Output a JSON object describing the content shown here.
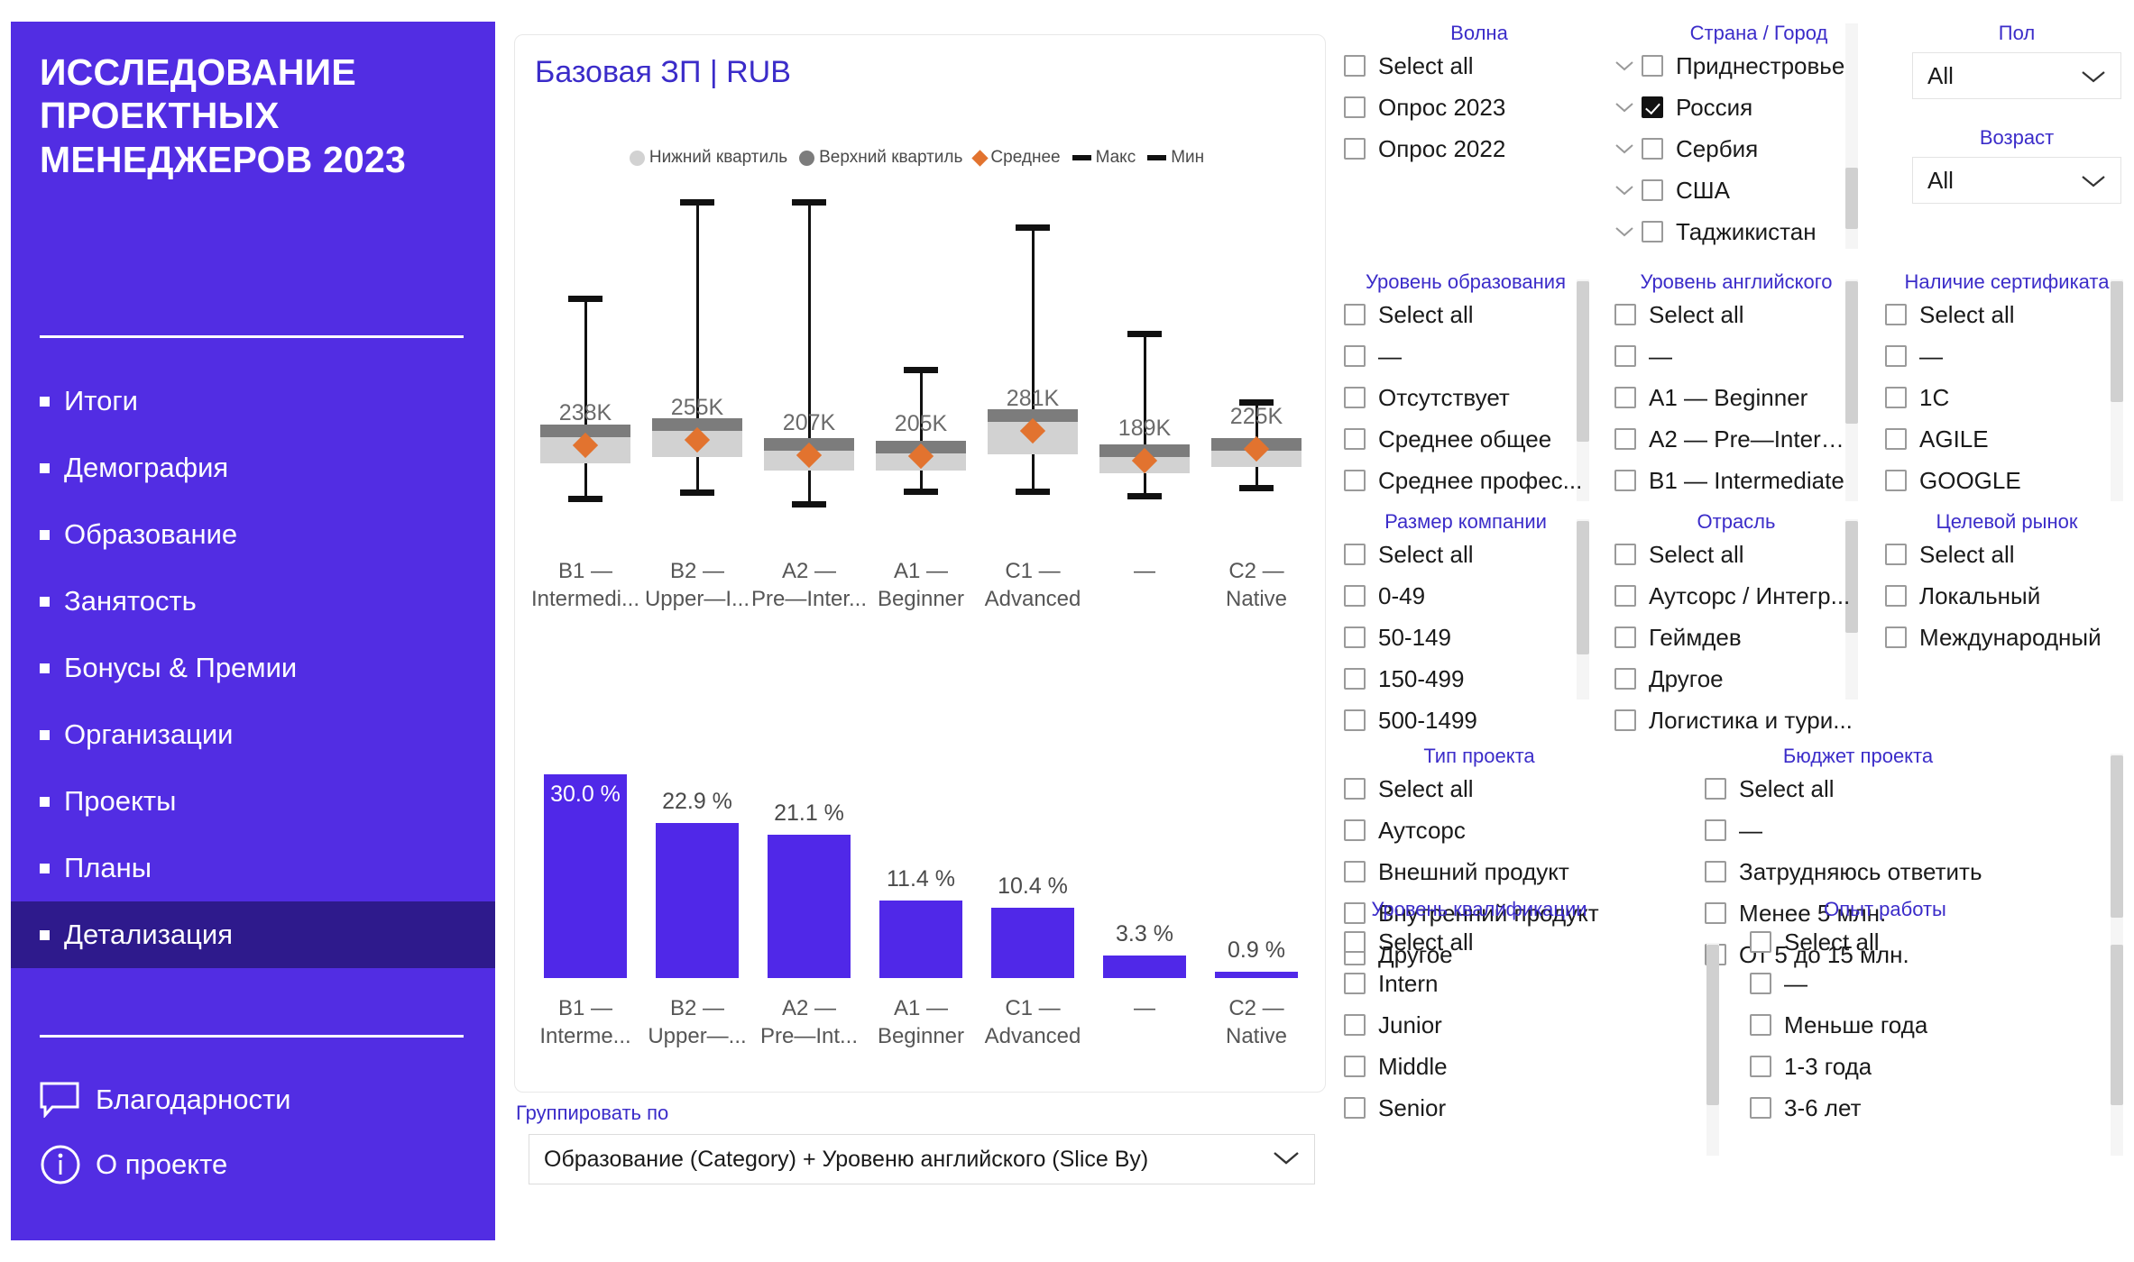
{
  "sidebar": {
    "brand_title": "ИССЛЕДОВАНИЕ ПРОЕКТНЫХ МЕНЕДЖЕРОВ 2023",
    "accent_color": "#522DE3",
    "active_color": "#2E1A8C",
    "items": [
      {
        "label": "Итоги",
        "active": false
      },
      {
        "label": "Демография",
        "active": false
      },
      {
        "label": "Образование",
        "active": false
      },
      {
        "label": "Занятость",
        "active": false
      },
      {
        "label": "Бонусы & Премии",
        "active": false
      },
      {
        "label": "Организации",
        "active": false
      },
      {
        "label": "Проекты",
        "active": false
      },
      {
        "label": "Планы",
        "active": false
      },
      {
        "label": "Детализация",
        "active": true
      }
    ],
    "footer": [
      {
        "label": "Благодарности",
        "icon": "speech-bubble-icon"
      },
      {
        "label": "О проекте",
        "icon": "info-circle-icon"
      }
    ]
  },
  "card": {
    "title": "Базовая ЗП | RUB",
    "legend": [
      {
        "label": "Нижний квартиль",
        "marker": "circle",
        "color": "#D2D2D2"
      },
      {
        "label": "Верхний квартиль",
        "marker": "circle",
        "color": "#7C7C7C"
      },
      {
        "label": "Среднее",
        "marker": "diamond",
        "color": "#E2732F"
      },
      {
        "label": "Макс",
        "marker": "dash",
        "color": "#111111"
      },
      {
        "label": "Мин",
        "marker": "dash",
        "color": "#111111"
      }
    ],
    "groupby_label": "Группировать по",
    "groupby_value": "Образование (Category) + Уровеню английского (Slice By)"
  },
  "chart_data": [
    {
      "type": "boxplot",
      "title": "Базовая ЗП | RUB",
      "xlabel": "",
      "ylabel": "RUB",
      "unit": "RUB",
      "value_suffix": "K",
      "categories": [
        "B1 — Intermedi...",
        "B2 — Upper—I...",
        "A2 — Pre—Inter...",
        "A1 — Beginner",
        "C1 — Advanced",
        "—",
        "C2 — Native"
      ],
      "category_lines": [
        [
          "B1 —",
          "Intermedi..."
        ],
        [
          "B2 —",
          "Upper—I..."
        ],
        [
          "A2 —",
          "Pre—Inter..."
        ],
        [
          "A1 —",
          "Beginner"
        ],
        [
          "C1 —",
          "Advanced"
        ],
        [
          "—",
          ""
        ],
        [
          "C2 —",
          "Native"
        ]
      ],
      "mean_labels": [
        "238K",
        "255K",
        "207K",
        "205K",
        "281K",
        "189K",
        "225K"
      ],
      "means": [
        238000,
        255000,
        207000,
        205000,
        281000,
        189000,
        225000
      ],
      "series": [
        {
          "name": "Макс",
          "values": [
            700000,
            1000000,
            1000000,
            480000,
            920000,
            590000,
            380000
          ]
        },
        {
          "name": "Верхний квартиль",
          "values": [
            300000,
            320000,
            260000,
            250000,
            350000,
            240000,
            260000
          ]
        },
        {
          "name": "Нижний квартиль",
          "values": [
            180000,
            200000,
            160000,
            160000,
            210000,
            150000,
            170000
          ]
        },
        {
          "name": "Мин",
          "values": [
            60000,
            80000,
            45000,
            85000,
            85000,
            70000,
            95000
          ]
        }
      ],
      "legend_position": "top",
      "grid": false
    },
    {
      "type": "bar",
      "title": "",
      "xlabel": "",
      "ylabel": "%",
      "categories": [
        "B1 — Interme...",
        "B2 — Upper—...",
        "A2 — Pre—Int...",
        "A1 — Beginner",
        "C1 — Advanced",
        "—",
        "C2 — Native"
      ],
      "category_lines": [
        [
          "B1 —",
          "Interme..."
        ],
        [
          "B2 —",
          "Upper—..."
        ],
        [
          "A2 —",
          "Pre—Int..."
        ],
        [
          "A1 —",
          "Beginner"
        ],
        [
          "C1 —",
          "Advanced"
        ],
        [
          "—",
          ""
        ],
        [
          "C2 —",
          "Native"
        ]
      ],
      "values": [
        30.0,
        22.9,
        21.1,
        11.4,
        10.4,
        3.3,
        0.9
      ],
      "value_labels": [
        "30.0 %",
        "22.9 %",
        "21.1 %",
        "11.4 %",
        "10.4 %",
        "3.3 %",
        "0.9 %"
      ],
      "ylim": [
        0,
        30.0
      ],
      "bar_color": "#5028E8",
      "grid": false,
      "legend_position": "none"
    }
  ],
  "slicers": {
    "wave": {
      "title": "Волна",
      "options": [
        {
          "label": "Select all",
          "checked": false
        },
        {
          "label": "Опрос 2023",
          "checked": false
        },
        {
          "label": "Опрос 2022",
          "checked": false
        }
      ]
    },
    "country": {
      "title": "Страна / Город",
      "options": [
        {
          "label": "Приднестровье",
          "checked": false,
          "expandable": true
        },
        {
          "label": "Россия",
          "checked": true,
          "expandable": true
        },
        {
          "label": "Сербия",
          "checked": false,
          "expandable": true
        },
        {
          "label": "США",
          "checked": false,
          "expandable": true
        },
        {
          "label": "Таджикистан",
          "checked": false,
          "expandable": true
        }
      ]
    },
    "gender": {
      "title": "Пол",
      "value": "All"
    },
    "age": {
      "title": "Возраст",
      "value": "All"
    },
    "education": {
      "title": "Уровень образования",
      "options": [
        {
          "label": "Select all",
          "checked": false
        },
        {
          "label": "—",
          "checked": false
        },
        {
          "label": "Отсутствует",
          "checked": false
        },
        {
          "label": "Среднее общее",
          "checked": false
        },
        {
          "label": "Среднее профес...",
          "checked": false
        }
      ]
    },
    "english": {
      "title": "Уровень английского",
      "options": [
        {
          "label": "Select all",
          "checked": false
        },
        {
          "label": "—",
          "checked": false
        },
        {
          "label": "A1 — Beginner",
          "checked": false
        },
        {
          "label": "A2 — Pre—Interm...",
          "checked": false
        },
        {
          "label": "B1 — Intermediate",
          "checked": false
        }
      ]
    },
    "certificate": {
      "title": "Наличие сертификата",
      "options": [
        {
          "label": "Select all",
          "checked": false
        },
        {
          "label": "—",
          "checked": false
        },
        {
          "label": "1C",
          "checked": false
        },
        {
          "label": "AGILE",
          "checked": false
        },
        {
          "label": "GOOGLE",
          "checked": false
        }
      ]
    },
    "company_size": {
      "title": "Размер компании",
      "options": [
        {
          "label": "Select all",
          "checked": false
        },
        {
          "label": "0-49",
          "checked": false
        },
        {
          "label": "50-149",
          "checked": false
        },
        {
          "label": "150-499",
          "checked": false
        },
        {
          "label": "500-1499",
          "checked": false
        }
      ]
    },
    "industry": {
      "title": "Отрасль",
      "options": [
        {
          "label": "Select all",
          "checked": false
        },
        {
          "label": "Аутсорс / Интегр...",
          "checked": false
        },
        {
          "label": "Геймдев",
          "checked": false
        },
        {
          "label": "Другое",
          "checked": false
        },
        {
          "label": "Логистика и тури...",
          "checked": false
        }
      ]
    },
    "target_market": {
      "title": "Целевой рынок",
      "options": [
        {
          "label": "Select all",
          "checked": false
        },
        {
          "label": "Локальный",
          "checked": false
        },
        {
          "label": "Международный",
          "checked": false
        }
      ]
    },
    "project_type": {
      "title": "Тип проекта",
      "options": [
        {
          "label": "Select all",
          "checked": false
        },
        {
          "label": "Аутсорс",
          "checked": false
        },
        {
          "label": "Внешний продукт",
          "checked": false
        },
        {
          "label": "Внутренний продукт",
          "checked": false
        },
        {
          "label": "Другое",
          "checked": false
        }
      ]
    },
    "project_budget": {
      "title": "Бюджет проекта",
      "options": [
        {
          "label": "Select all",
          "checked": false
        },
        {
          "label": "—",
          "checked": false
        },
        {
          "label": "Затрудняюсь ответить",
          "checked": false
        },
        {
          "label": "Менее 5 млн.",
          "checked": false
        },
        {
          "label": "От 5 до 15 млн.",
          "checked": false
        }
      ]
    },
    "qualification": {
      "title": "Уровень квалификации",
      "options": [
        {
          "label": "Select all",
          "checked": false
        },
        {
          "label": "Intern",
          "checked": false
        },
        {
          "label": "Junior",
          "checked": false
        },
        {
          "label": "Middle",
          "checked": false
        },
        {
          "label": "Senior",
          "checked": false
        }
      ]
    },
    "experience": {
      "title": "Опыт работы",
      "options": [
        {
          "label": "Select all",
          "checked": false
        },
        {
          "label": "—",
          "checked": false
        },
        {
          "label": "Меньше года",
          "checked": false
        },
        {
          "label": "1-3 года",
          "checked": false
        },
        {
          "label": "3-6 лет",
          "checked": false
        }
      ]
    }
  }
}
